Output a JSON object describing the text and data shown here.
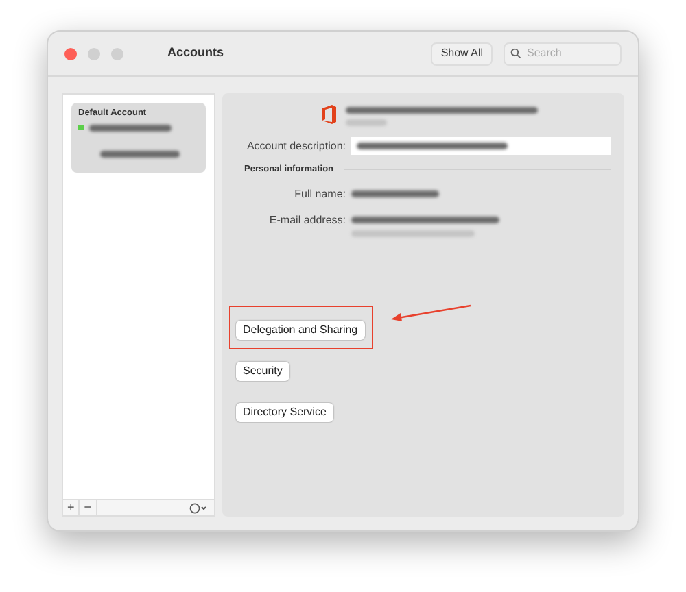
{
  "window": {
    "title": "Accounts"
  },
  "toolbar": {
    "show_all": "Show All",
    "search": {
      "placeholder": "Search"
    }
  },
  "sidebar": {
    "items": [
      {
        "label": "Default Account",
        "selected": true
      }
    ],
    "footer": {
      "add": "+",
      "remove": "−"
    }
  },
  "details": {
    "description_label": "Account description:",
    "section_title": "Personal information",
    "fields": [
      {
        "label": "Full name:"
      },
      {
        "label": "E-mail address:"
      }
    ]
  },
  "buttons": [
    {
      "label": "Delegation and Sharing",
      "highlighted": true
    },
    {
      "label": "Security",
      "highlighted": false
    },
    {
      "label": "Directory Service",
      "highlighted": false
    }
  ]
}
